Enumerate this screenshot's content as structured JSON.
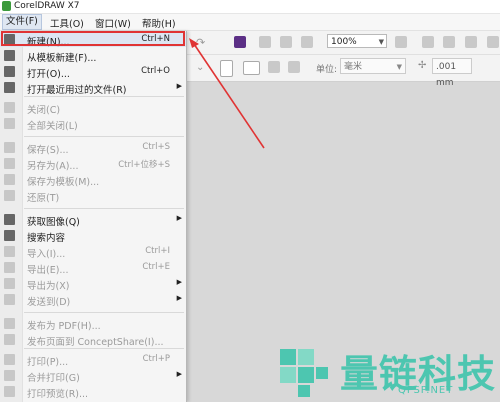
{
  "app": {
    "title": "CorelDRAW X7"
  },
  "menubar": [
    {
      "label": "文件(F)",
      "active": true
    },
    {
      "label": "工具(O)"
    },
    {
      "label": "窗口(W)"
    },
    {
      "label": "帮助(H)"
    }
  ],
  "toolbar": {
    "zoom": "100%",
    "unit_label": "单位:",
    "unit_value": "毫米",
    "nudge_value": ".001 mm"
  },
  "file_menu": {
    "items": [
      {
        "label": "新建(N)...",
        "shortcut": "Ctrl+N",
        "enabled": true,
        "highlight": true
      },
      {
        "label": "从模板新建(F)...",
        "enabled": true
      },
      {
        "label": "打开(O)...",
        "shortcut": "Ctrl+O",
        "enabled": true
      },
      {
        "label": "打开最近用过的文件(R)",
        "enabled": true,
        "submenu": true
      },
      {
        "label": "关闭(C)",
        "enabled": false
      },
      {
        "label": "全部关闭(L)",
        "enabled": false
      },
      {
        "label": "保存(S)...",
        "shortcut": "Ctrl+S",
        "enabled": false
      },
      {
        "label": "另存为(A)...",
        "shortcut": "Ctrl+位移+S",
        "enabled": false
      },
      {
        "label": "保存为模板(M)...",
        "enabled": false
      },
      {
        "label": "还原(T)",
        "enabled": false
      },
      {
        "label": "获取图像(Q)",
        "enabled": true,
        "submenu": true
      },
      {
        "label": "搜索内容",
        "enabled": true
      },
      {
        "label": "导入(I)...",
        "shortcut": "Ctrl+I",
        "enabled": false
      },
      {
        "label": "导出(E)...",
        "shortcut": "Ctrl+E",
        "enabled": false
      },
      {
        "label": "导出为(X)",
        "enabled": false,
        "submenu": true
      },
      {
        "label": "发送到(D)",
        "enabled": false,
        "submenu": true
      },
      {
        "label": "发布为 PDF(H)...",
        "enabled": false
      },
      {
        "label": "发布页面到 ConceptShare(I)...",
        "enabled": false
      },
      {
        "label": "打印(P)...",
        "shortcut": "Ctrl+P",
        "enabled": false
      },
      {
        "label": "合并打印(G)",
        "enabled": false,
        "submenu": true
      },
      {
        "label": "打印预览(R)...",
        "enabled": false
      }
    ]
  },
  "icons": {
    "submenu_arrow": "▶",
    "dropdown_arrow": "▼"
  },
  "watermark": {
    "text": "量链科技",
    "sub": "QFSP.NET"
  },
  "colors": {
    "highlight_border": "#e03434",
    "watermark": "#4dc6b0"
  }
}
